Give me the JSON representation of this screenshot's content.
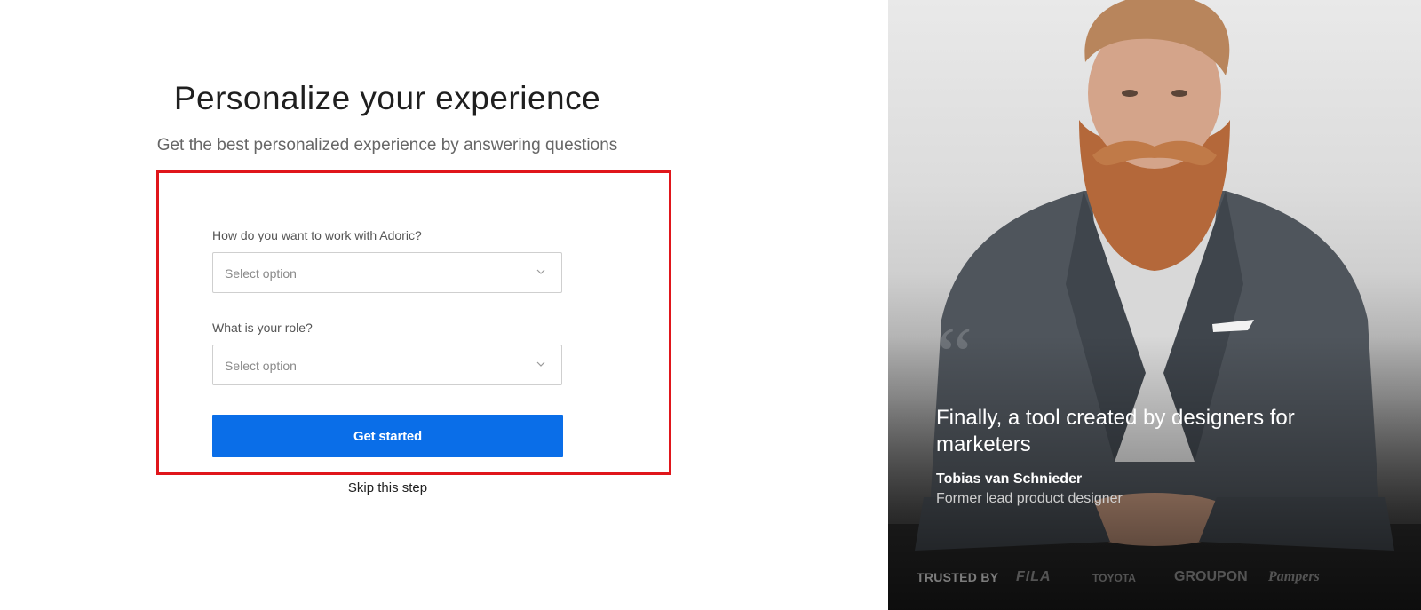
{
  "header": {
    "title": "Personalize your experience",
    "subtitle": "Get the best personalized experience by answering questions"
  },
  "form": {
    "work_label": "How do you want to work with Adoric?",
    "work_placeholder": "Select option",
    "role_label": "What is your role?",
    "role_placeholder": "Select option",
    "submit_label": "Get started",
    "skip_label": "Skip this step"
  },
  "testimonial": {
    "quote": "Finally, a tool created by designers for marketers",
    "name": "Tobias van Schnieder",
    "role": "Former lead product designer"
  },
  "trusted": {
    "label": "TRUSTED BY",
    "logos": [
      "FILA",
      "TOYOTA",
      "GROUPON",
      "Pampers"
    ]
  },
  "colors": {
    "primary_button": "#0a6ee8",
    "highlight_border": "#e0161b"
  }
}
